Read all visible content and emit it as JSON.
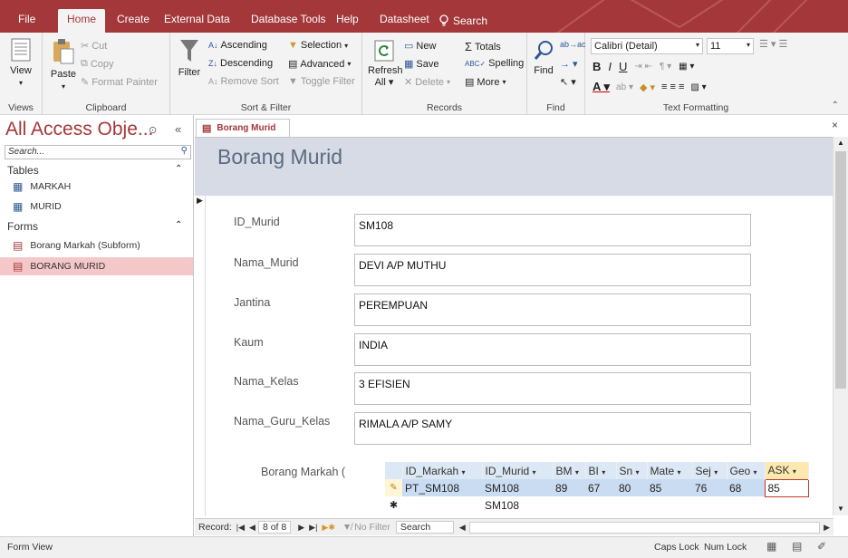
{
  "tabs": [
    "File",
    "Home",
    "Create",
    "External Data",
    "Database Tools",
    "Help",
    "Datasheet"
  ],
  "tell_me": "Search",
  "ribbon": {
    "views": {
      "label": "View",
      "group": "Views"
    },
    "clipboard": {
      "paste": "Paste",
      "cut": "Cut",
      "copy": "Copy",
      "format_painter": "Format Painter",
      "group": "Clipboard"
    },
    "sort_filter": {
      "filter": "Filter",
      "ascending": "Ascending",
      "descending": "Descending",
      "remove_sort": "Remove Sort",
      "selection": "Selection",
      "advanced": "Advanced",
      "toggle_filter": "Toggle Filter",
      "group": "Sort & Filter"
    },
    "records": {
      "refresh": "Refresh",
      "refresh_all": "All",
      "new": "New",
      "save": "Save",
      "delete": "Delete",
      "totals": "Totals",
      "spelling": "Spelling",
      "more": "More",
      "group": "Records"
    },
    "find": {
      "find": "Find",
      "group": "Find"
    },
    "text_formatting": {
      "font": "Calibri (Detail)",
      "size": "11",
      "group": "Text Formatting"
    }
  },
  "nav": {
    "title": "All Access Obje...",
    "search_placeholder": "Search...",
    "sections": [
      {
        "label": "Tables",
        "items": [
          "MARKAH",
          "MURID"
        ]
      },
      {
        "label": "Forms",
        "items": [
          "Borang Markah (Subform)",
          "BORANG MURID"
        ]
      }
    ],
    "selected": "BORANG MURID"
  },
  "document_tab": "Borang Murid",
  "form": {
    "title": "Borang Murid",
    "fields": [
      {
        "label": "ID_Murid",
        "value": "SM108"
      },
      {
        "label": "Nama_Murid",
        "value": "DEVI A/P MUTHU"
      },
      {
        "label": "Jantina",
        "value": "PEREMPUAN"
      },
      {
        "label": "Kaum",
        "value": "INDIA"
      },
      {
        "label": "Nama_Kelas",
        "value": "3 EFISIEN"
      },
      {
        "label": "Nama_Guru_Kelas",
        "value": "RIMALA A/P SAMY"
      }
    ],
    "subform_label": "Borang Markah (",
    "subform": {
      "columns": [
        "ID_Markah",
        "ID_Murid",
        "BM",
        "BI",
        "Sn",
        "Mate",
        "Sej",
        "Geo",
        "ASK"
      ],
      "rows": [
        [
          "PT_SM108",
          "SM108",
          "89",
          "67",
          "80",
          "85",
          "76",
          "68",
          "85"
        ]
      ],
      "new_row": [
        "",
        "SM108",
        "",
        "",
        "",
        "",
        "",
        "",
        ""
      ]
    }
  },
  "record_nav": {
    "label": "Record:",
    "position": "8 of 8",
    "no_filter": "No Filter",
    "search": "Search"
  },
  "status": {
    "left": "Form View",
    "caps": "Caps Lock",
    "num": "Num Lock"
  },
  "colors": {
    "accent": "#a4373a",
    "header_band": "#d6dbe5",
    "selected_nav": "#f4c7c9",
    "highlight_col": "#fde9b0"
  }
}
